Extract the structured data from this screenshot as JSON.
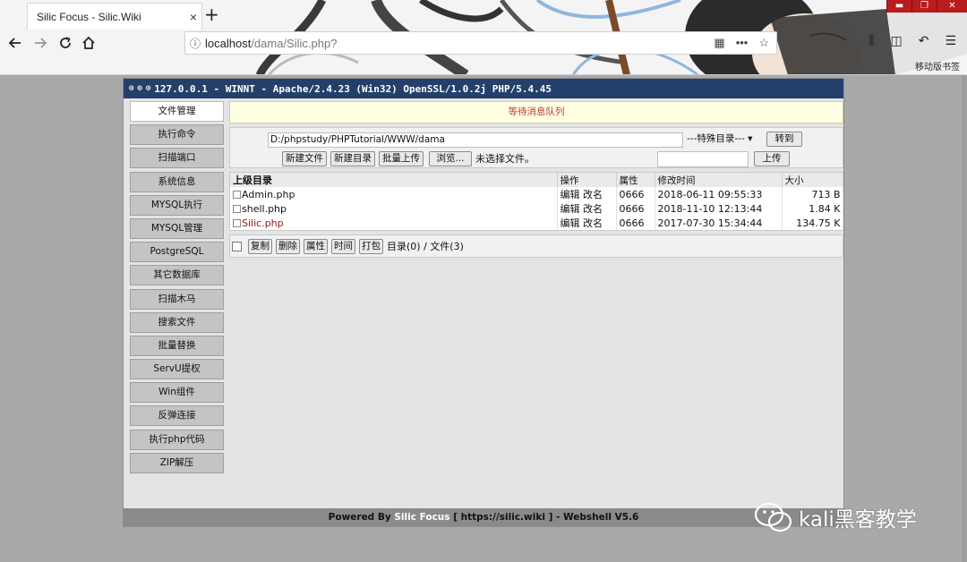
{
  "browser": {
    "tab_title": "Silic Focus - Silic.Wiki",
    "tab_close": "×",
    "new_tab": "+",
    "url_host": "localhost",
    "url_path": "/dama/Silic.php?",
    "mobile_bookmarks": "移动版书签",
    "window_controls": [
      "▬",
      "❐",
      "✕"
    ]
  },
  "shell": {
    "title": "127.0.0.1 - WINNT - Apache/2.4.23 (Win32) OpenSSL/1.0.2j PHP/5.4.45",
    "sidebar": [
      "文件管理",
      "执行命令",
      "扫描端口",
      "系统信息",
      "MYSQL执行",
      "MYSQL管理",
      "PostgreSQL",
      "其它数据库",
      "扫描木马",
      "搜索文件",
      "批量替换",
      "ServU提权",
      "Win组件",
      "反弹连接",
      "执行php代码",
      "ZIP解压"
    ],
    "queue_message": "等待消息队列",
    "path_value": "D:/phpstudy/PHPTutorial/WWW/dama",
    "special_dir": "---特殊目录---",
    "goto_btn": "转到",
    "new_file_btn": "新建文件",
    "new_dir_btn": "新建目录",
    "batch_upload_btn": "批量上传",
    "browse_btn": "浏览...",
    "no_file": "未选择文件。",
    "upload_btn": "上传",
    "table": {
      "headers": [
        "上级目录",
        "操作",
        "属性",
        "修改时间",
        "大小"
      ],
      "rows": [
        {
          "name": "Admin.php",
          "ops": "编辑 改名",
          "attr": "0666",
          "mtime": "2018-06-11 09:55:33",
          "size": "713 B"
        },
        {
          "name": "shell.php",
          "ops": "编辑 改名",
          "attr": "0666",
          "mtime": "2018-11-10 12:13:44",
          "size": "1.84 K"
        },
        {
          "name": "Silic.php",
          "ops": "编辑 改名",
          "attr": "0666",
          "mtime": "2017-07-30 15:34:44",
          "size": "134.75 K"
        }
      ]
    },
    "actions": [
      "复制",
      "删除",
      "属性",
      "时间",
      "打包"
    ],
    "summary": "目录(0) / 文件(3)",
    "footer_prefix": "Powered By",
    "footer_brand": "Silic Focus",
    "footer_suffix": "[ https://silic.wiki ] - Webshell V5.6"
  },
  "watermark": "kali黑客教学",
  "colors": {
    "title_bar": "#24406a",
    "queue_text": "#c0392b",
    "page_bg": "#a9a9a9"
  }
}
